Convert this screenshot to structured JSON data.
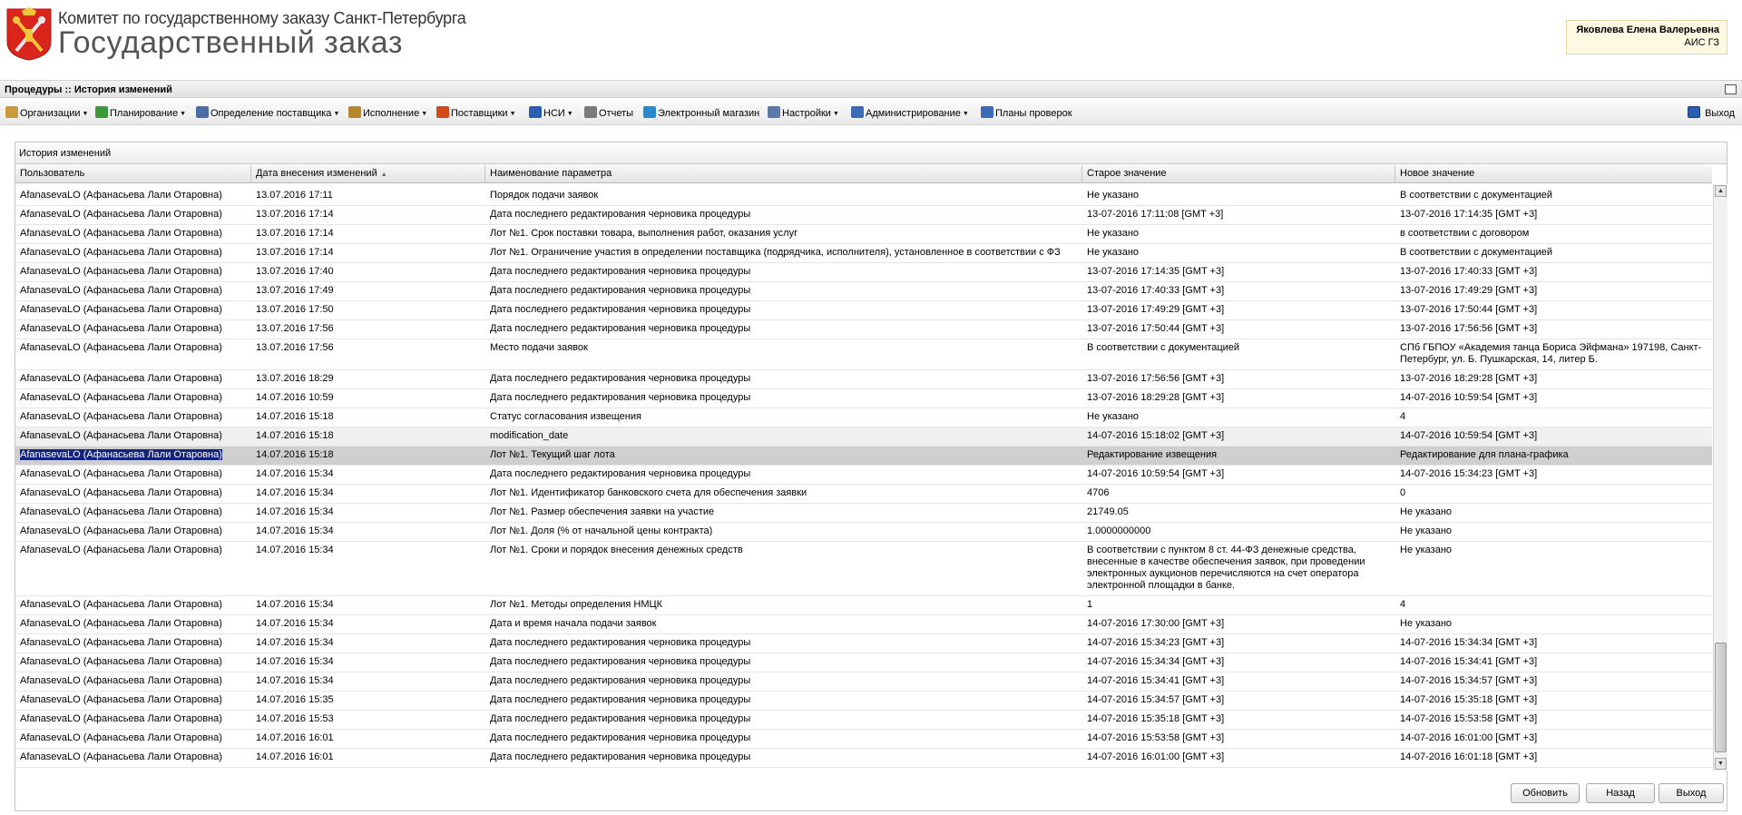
{
  "header": {
    "org_name": "Комитет по государственному заказу Санкт-Петербурга",
    "app_name": "Государственный заказ",
    "user_name": "Яковлева Елена Валерьевна",
    "user_system": "АИС ГЗ"
  },
  "titlebar": {
    "title": "Процедуры :: История изменений"
  },
  "menu": [
    {
      "label": "Организации",
      "has_dropdown": true,
      "icon": "folder-icon",
      "color": "#c89a3a"
    },
    {
      "label": "Планирование",
      "has_dropdown": true,
      "icon": "tree-icon",
      "color": "#3a9a3a"
    },
    {
      "label": "Определение поставщика",
      "has_dropdown": true,
      "icon": "network-icon",
      "color": "#4a6fa8"
    },
    {
      "label": "Исполнение",
      "has_dropdown": true,
      "icon": "box-icon",
      "color": "#b8862c"
    },
    {
      "label": "Поставщики",
      "has_dropdown": true,
      "icon": "clock-icon",
      "color": "#d04a1a"
    },
    {
      "label": "НСИ",
      "has_dropdown": true,
      "icon": "book-icon",
      "color": "#2a5db0"
    },
    {
      "label": "Отчеты",
      "has_dropdown": false,
      "icon": "report-icon",
      "color": "#7a7a7a"
    },
    {
      "label": "Электронный магазин",
      "has_dropdown": false,
      "icon": "cart-icon",
      "color": "#2a8ad0"
    },
    {
      "label": "Настройки",
      "has_dropdown": true,
      "icon": "wrench-icon",
      "color": "#5a7aa8"
    },
    {
      "label": "Администрирование",
      "has_dropdown": true,
      "icon": "user-icon",
      "color": "#3a6ab8"
    },
    {
      "label": "Планы проверок",
      "has_dropdown": false,
      "icon": "user-check-icon",
      "color": "#3a6ab8"
    }
  ],
  "exit_label": "Выход",
  "panel": {
    "title": "История изменений",
    "columns": [
      "Пользователь",
      "Дата внесения изменений",
      "Наименование параметра",
      "Старое значение",
      "Новое значение"
    ],
    "rows": [
      {
        "user": "AfanasevaLO (Афанасьева Лали Отаровна)",
        "date": "13.07.2016 17:11",
        "param": "Порядок подачи заявок",
        "old": "Не указано",
        "new": "В соответствии с документацией"
      },
      {
        "user": "AfanasevaLO (Афанасьева Лали Отаровна)",
        "date": "13.07.2016 17:14",
        "param": "Дата последнего редактирования черновика процедуры",
        "old": "13-07-2016 17:11:08 [GMT +3]",
        "new": "13-07-2016 17:14:35 [GMT +3]"
      },
      {
        "user": "AfanasevaLO (Афанасьева Лали Отаровна)",
        "date": "13.07.2016 17:14",
        "param": "Лот №1. Срок поставки товара, выполнения работ, оказания услуг",
        "old": "Не указано",
        "new": "в соответствии с договором"
      },
      {
        "user": "AfanasevaLO (Афанасьева Лали Отаровна)",
        "date": "13.07.2016 17:14",
        "param": "Лот №1. Ограничение участия в определении поставщика (подрядчика, исполнителя), установленное в соответствии с ФЗ",
        "old": "Не указано",
        "new": "В соответствии с документацией"
      },
      {
        "user": "AfanasevaLO (Афанасьева Лали Отаровна)",
        "date": "13.07.2016 17:40",
        "param": "Дата последнего редактирования черновика процедуры",
        "old": "13-07-2016 17:14:35 [GMT +3]",
        "new": "13-07-2016 17:40:33 [GMT +3]"
      },
      {
        "user": "AfanasevaLO (Афанасьева Лали Отаровна)",
        "date": "13.07.2016 17:49",
        "param": "Дата последнего редактирования черновика процедуры",
        "old": "13-07-2016 17:40:33 [GMT +3]",
        "new": "13-07-2016 17:49:29 [GMT +3]"
      },
      {
        "user": "AfanasevaLO (Афанасьева Лали Отаровна)",
        "date": "13.07.2016 17:50",
        "param": "Дата последнего редактирования черновика процедуры",
        "old": "13-07-2016 17:49:29 [GMT +3]",
        "new": "13-07-2016 17:50:44 [GMT +3]"
      },
      {
        "user": "AfanasevaLO (Афанасьева Лали Отаровна)",
        "date": "13.07.2016 17:56",
        "param": "Дата последнего редактирования черновика процедуры",
        "old": "13-07-2016 17:50:44 [GMT +3]",
        "new": "13-07-2016 17:56:56 [GMT +3]"
      },
      {
        "user": "AfanasevaLO (Афанасьева Лали Отаровна)",
        "date": "13.07.2016 17:56",
        "param": "Место подачи заявок",
        "old": "В соответствии с документацией",
        "new": "СПб ГБПОУ «Академия танца Бориса Эйфмана» 197198, Санкт-Петербург, ул. Б. Пушкарская, 14, литер Б."
      },
      {
        "user": "AfanasevaLO (Афанасьева Лали Отаровна)",
        "date": "13.07.2016 18:29",
        "param": "Дата последнего редактирования черновика процедуры",
        "old": "13-07-2016 17:56:56 [GMT +3]",
        "new": "13-07-2016 18:29:28 [GMT +3]"
      },
      {
        "user": "AfanasevaLO (Афанасьева Лали Отаровна)",
        "date": "14.07.2016 10:59",
        "param": "Дата последнего редактирования черновика процедуры",
        "old": "13-07-2016 18:29:28 [GMT +3]",
        "new": "14-07-2016 10:59:54 [GMT +3]"
      },
      {
        "user": "AfanasevaLO (Афанасьева Лали Отаровна)",
        "date": "14.07.2016 15:18",
        "param": "Статус согласования извещения",
        "old": "Не указано",
        "new": "4"
      },
      {
        "user": "AfanasevaLO (Афанасьева Лали Отаровна)",
        "date": "14.07.2016 15:18",
        "param": "modification_date",
        "old": "14-07-2016 15:18:02 [GMT +3]",
        "new": "14-07-2016 10:59:54 [GMT +3]"
      },
      {
        "user": "AfanasevaLO (Афанасьева Лали Отаровна)",
        "date": "14.07.2016 15:18",
        "param": "Лот №1. Текущий шаг лота",
        "old": "Редактирование извещения",
        "new": "Редактирование для плана-графика"
      },
      {
        "user": "AfanasevaLO (Афанасьева Лали Отаровна)",
        "date": "14.07.2016 15:34",
        "param": "Дата последнего редактирования черновика процедуры",
        "old": "14-07-2016 10:59:54 [GMT +3]",
        "new": "14-07-2016 15:34:23 [GMT +3]"
      },
      {
        "user": "AfanasevaLO (Афанасьева Лали Отаровна)",
        "date": "14.07.2016 15:34",
        "param": "Лот №1. Идентификатор банковского счета для обеспечения заявки",
        "old": "4706",
        "new": "0"
      },
      {
        "user": "AfanasevaLO (Афанасьева Лали Отаровна)",
        "date": "14.07.2016 15:34",
        "param": "Лот №1. Размер обеспечения заявки на участие",
        "old": "21749.05",
        "new": "Не указано"
      },
      {
        "user": "AfanasevaLO (Афанасьева Лали Отаровна)",
        "date": "14.07.2016 15:34",
        "param": "Лот №1. Доля (% от начальной цены контракта)",
        "old": "1.0000000000",
        "new": "Не указано"
      },
      {
        "user": "AfanasevaLO (Афанасьева Лали Отаровна)",
        "date": "14.07.2016 15:34",
        "param": "Лот №1. Сроки и порядок внесения денежных средств",
        "old": "В соответствии с пунктом 8 ст. 44-ФЗ денежные средства, внесенные в качестве обеспечения заявок, при проведении электронных аукционов перечисляются на счет оператора электронной площадки в банке.",
        "new": "Не указано"
      },
      {
        "user": "AfanasevaLO (Афанасьева Лали Отаровна)",
        "date": "14.07.2016 15:34",
        "param": "Лот №1. Методы определения НМЦК",
        "old": "1",
        "new": "4"
      },
      {
        "user": "AfanasevaLO (Афанасьева Лали Отаровна)",
        "date": "14.07.2016 15:34",
        "param": "Дата и время начала подачи заявок",
        "old": "14-07-2016 17:30:00 [GMT +3]",
        "new": "Не указано"
      },
      {
        "user": "AfanasevaLO (Афанасьева Лали Отаровна)",
        "date": "14.07.2016 15:34",
        "param": "Дата последнего редактирования черновика процедуры",
        "old": "14-07-2016 15:34:23 [GMT +3]",
        "new": "14-07-2016 15:34:34 [GMT +3]"
      },
      {
        "user": "AfanasevaLO (Афанасьева Лали Отаровна)",
        "date": "14.07.2016 15:34",
        "param": "Дата последнего редактирования черновика процедуры",
        "old": "14-07-2016 15:34:34 [GMT +3]",
        "new": "14-07-2016 15:34:41 [GMT +3]"
      },
      {
        "user": "AfanasevaLO (Афанасьева Лали Отаровна)",
        "date": "14.07.2016 15:34",
        "param": "Дата последнего редактирования черновика процедуры",
        "old": "14-07-2016 15:34:41 [GMT +3]",
        "new": "14-07-2016 15:34:57 [GMT +3]"
      },
      {
        "user": "AfanasevaLO (Афанасьева Лали Отаровна)",
        "date": "14.07.2016 15:35",
        "param": "Дата последнего редактирования черновика процедуры",
        "old": "14-07-2016 15:34:57 [GMT +3]",
        "new": "14-07-2016 15:35:18 [GMT +3]"
      },
      {
        "user": "AfanasevaLO (Афанасьева Лали Отаровна)",
        "date": "14.07.2016 15:53",
        "param": "Дата последнего редактирования черновика процедуры",
        "old": "14-07-2016 15:35:18 [GMT +3]",
        "new": "14-07-2016 15:53:58 [GMT +3]"
      },
      {
        "user": "AfanasevaLO (Афанасьева Лали Отаровна)",
        "date": "14.07.2016 16:01",
        "param": "Дата последнего редактирования черновика процедуры",
        "old": "14-07-2016 15:53:58 [GMT +3]",
        "new": "14-07-2016 16:01:00 [GMT +3]"
      },
      {
        "user": "AfanasevaLO (Афанасьева Лали Отаровна)",
        "date": "14.07.2016 16:01",
        "param": "Дата последнего редактирования черновика процедуры",
        "old": "14-07-2016 16:01:00 [GMT +3]",
        "new": "14-07-2016 16:01:18 [GMT +3]"
      }
    ],
    "hover_row_index": 12,
    "selected_row_index": 13
  },
  "buttons": {
    "refresh": "Обновить",
    "back": "Назад",
    "exit": "Выход"
  },
  "colors": {
    "selected_row": "#cfcfcf",
    "selection_text": "#13237a",
    "user_box_bg": "#fdf9e2",
    "crest_red": "#d9251c"
  }
}
